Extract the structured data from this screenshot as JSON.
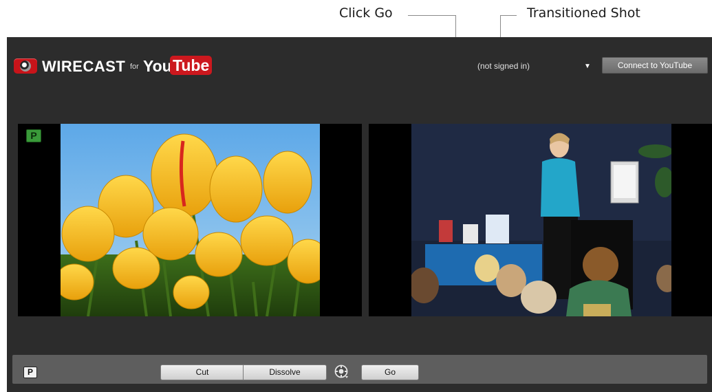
{
  "callouts": {
    "click_go": "Click Go",
    "transitioned_shot": "Transitioned Shot"
  },
  "header": {
    "brand_name": "WIRECAST",
    "brand_for": "for",
    "brand_you": "You",
    "brand_tube": "Tube",
    "signin_status": "(not signed in)",
    "connect_label": "Connect to YouTube"
  },
  "preview": {
    "preview_badge": "P"
  },
  "transition_bar": {
    "preview_badge": "P",
    "cut_label": "Cut",
    "dissolve_label": "Dissolve",
    "go_label": "Go"
  },
  "colors": {
    "app_background": "#2c2c2c",
    "bottom_bar": "#5e5e5e",
    "preview_badge": "#3a9a3a",
    "youtube_red": "#cc181e"
  },
  "icons": [
    "camera-lens-icon",
    "dropdown-arrow-icon",
    "transition-speed-icon"
  ]
}
